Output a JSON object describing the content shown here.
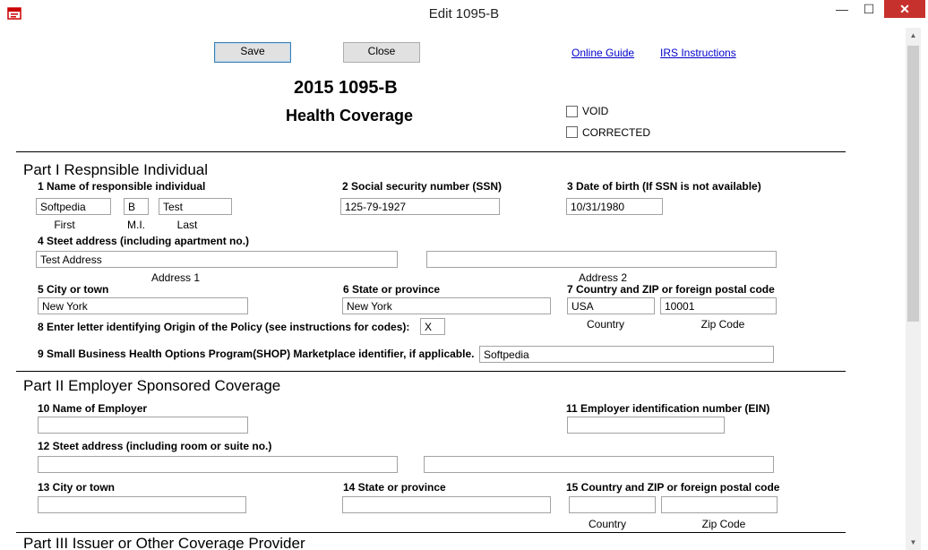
{
  "window": {
    "title": "Edit 1095-B",
    "minimize": "—",
    "maximize": "☐",
    "close": "✕"
  },
  "toolbar": {
    "save_label": "Save",
    "close_label": "Close",
    "online_guide": "Online Guide",
    "irs_instructions": "IRS Instructions"
  },
  "form": {
    "title": "2015 1095-B",
    "subtitle": "Health Coverage",
    "void_label": "VOID",
    "corrected_label": "CORRECTED"
  },
  "part1": {
    "heading": "Part I Respnsible Individual",
    "l1": "1 Name of responsible individual",
    "first": "Softpedia",
    "mi": "B",
    "last": "Test",
    "cap_first": "First",
    "cap_mi": "M.I.",
    "cap_last": "Last",
    "l2": "2 Social security number (SSN)",
    "ssn": "125-79-1927",
    "l3": "3 Date of birth (If SSN is not available)",
    "dob": "10/31/1980",
    "l4": "4 Steet address (including apartment no.)",
    "addr1": "Test Address",
    "addr2": "",
    "cap_addr1": "Address 1",
    "cap_addr2": "Address 2",
    "l5": "5 City or town",
    "city": "New York",
    "l6": "6 State or province",
    "state": "New York",
    "l7": "7 Country and ZIP or foreign postal code",
    "country": "USA",
    "zip": "10001",
    "cap_country": "Country",
    "cap_zip": "Zip Code",
    "l8": "8 Enter letter identifying Origin of the Policy (see instructions for codes):",
    "origin": "X",
    "l9": "9 Small Business Health Options Program(SHOP) Marketplace identifier, if applicable.",
    "shop": "Softpedia"
  },
  "part2": {
    "heading": "Part II Employer Sponsored Coverage",
    "l10": "10 Name of Employer",
    "employer": "",
    "l11": "11 Employer identification number (EIN)",
    "ein": "",
    "l12": "12 Steet address (including room or suite no.)",
    "addr1": "",
    "addr2": "",
    "l13": "13 City or town",
    "city": "",
    "l14": "14 State or province",
    "state": "",
    "l15": "15 Country and ZIP or foreign postal code",
    "country": "",
    "zip": "",
    "cap_country": "Country",
    "cap_zip": "Zip Code"
  },
  "part3": {
    "heading": "Part III Issuer or Other Coverage Provider"
  }
}
